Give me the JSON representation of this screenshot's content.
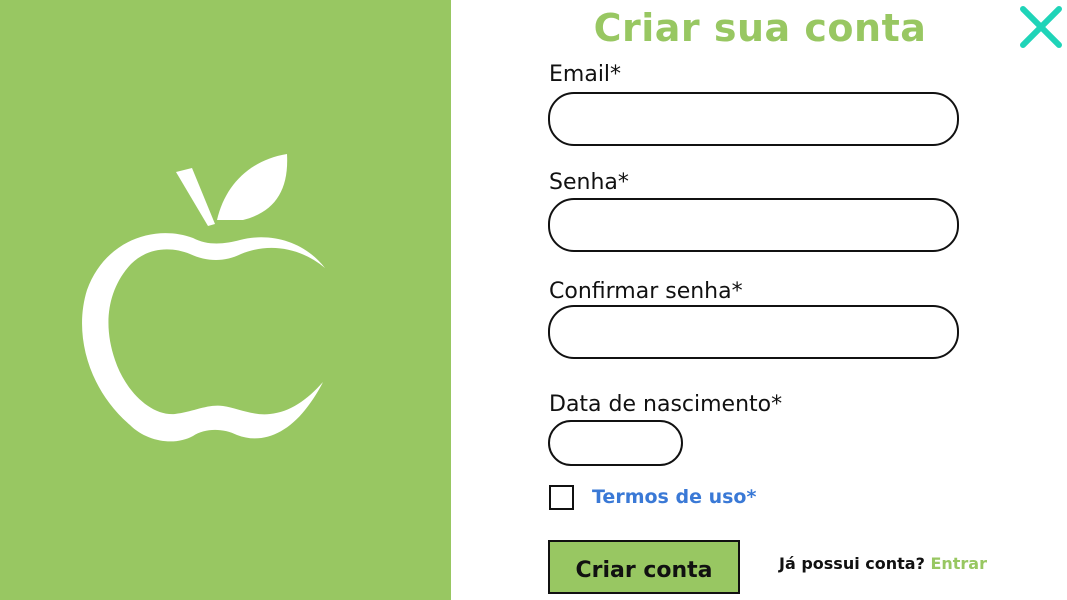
{
  "form": {
    "title": "Criar sua conta",
    "email_label": "Email*",
    "email_value": "",
    "password_label": "Senha*",
    "password_value": "",
    "confirm_label": "Confirmar senha*",
    "confirm_value": "",
    "birthdate_label": "Data de nascimento*",
    "birthdate_value": "",
    "terms_label": "Termos de uso*",
    "submit_label": "Criar conta",
    "login_prompt": "Já possui conta?",
    "login_link": "Entrar"
  },
  "icons": {
    "logo": "apple-icon",
    "close": "close-icon"
  },
  "colors": {
    "brand_green": "#98c762",
    "close_teal": "#1fd4b8",
    "link_blue": "#3a79d6"
  }
}
